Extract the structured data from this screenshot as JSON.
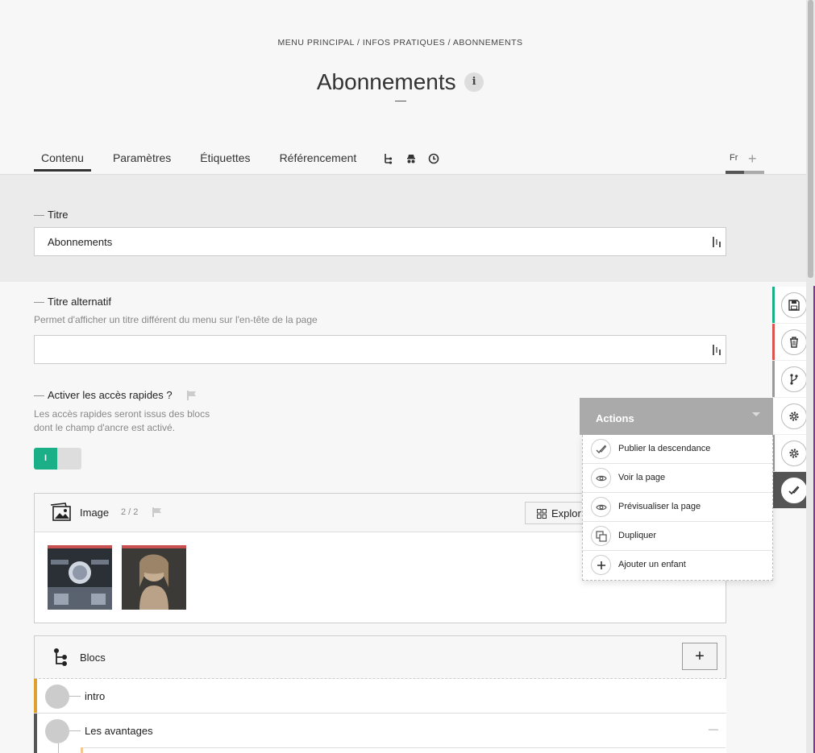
{
  "breadcrumb": "MENU PRINCIPAL  /  INFOS PRATIQUES  /  ABONNEMENTS",
  "page_title": "Abonnements",
  "info_badge": "i",
  "tabs": {
    "contenu": "Contenu",
    "parametres": "Paramètres",
    "etiquettes": "Étiquettes",
    "referencement": "Référencement"
  },
  "language": "Fr",
  "fields": {
    "titre": {
      "label": "Titre",
      "value": "Abonnements"
    },
    "titre_alt": {
      "label": "Titre alternatif",
      "description": "Permet d'afficher un titre différent du menu sur l'en-tête de la page",
      "value": ""
    },
    "acces_rapides": {
      "label": "Activer les accès rapides ?",
      "description_1": "Les accès rapides seront issus des blocs",
      "description_2": "dont le champ d'ancre est activé.",
      "toggle_label": "I",
      "enabled": true
    }
  },
  "image_panel": {
    "title": "Image",
    "count": "2 / 2",
    "explore_label": "Explor"
  },
  "blocks_panel": {
    "title": "Blocs",
    "add_label": "+"
  },
  "blocks": [
    {
      "label": "intro",
      "accent": "#e0a030"
    },
    {
      "label": "Les avantages",
      "accent": "#555555",
      "collapse": "—"
    }
  ],
  "actions_menu": {
    "title": "Actions",
    "items": [
      {
        "label": "Publier la descendance",
        "icon": "publish-icon"
      },
      {
        "label": "Voir la page",
        "icon": "eye-icon"
      },
      {
        "label": "Prévisualiser la page",
        "icon": "eye-icon"
      },
      {
        "label": "Dupliquer",
        "icon": "duplicate-icon"
      },
      {
        "label": "Ajouter un enfant",
        "icon": "plus-icon"
      }
    ]
  },
  "colors": {
    "accent_green": "#1aaf87",
    "accent_red": "#d9534f",
    "highlight_purple": "#8a2e9b"
  }
}
